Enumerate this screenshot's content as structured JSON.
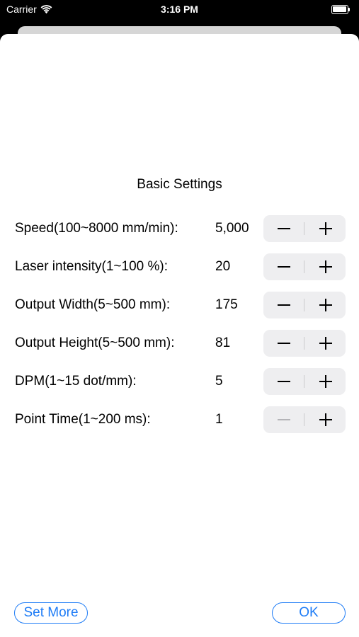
{
  "status_bar": {
    "carrier": "Carrier",
    "time": "3:16 PM",
    "icons": [
      "wifi-icon",
      "battery-icon"
    ]
  },
  "title": "Basic Settings",
  "settings": [
    {
      "label": "Speed(100~8000 mm/min):",
      "value": "5,000",
      "minus_enabled": true,
      "plus_enabled": true
    },
    {
      "label": "Laser intensity(1~100 %):",
      "value": "20",
      "minus_enabled": true,
      "plus_enabled": true
    },
    {
      "label": "Output Width(5~500 mm):",
      "value": "175",
      "minus_enabled": true,
      "plus_enabled": true
    },
    {
      "label": "Output Height(5~500 mm):",
      "value": "81",
      "minus_enabled": true,
      "plus_enabled": true
    },
    {
      "label": "DPM(1~15 dot/mm):",
      "value": "5",
      "minus_enabled": true,
      "plus_enabled": true
    },
    {
      "label": "Point Time(1~200 ms):",
      "value": "1",
      "minus_enabled": false,
      "plus_enabled": true
    }
  ],
  "buttons": {
    "set_more": "Set More",
    "ok": "OK"
  },
  "colors": {
    "accent": "#1e7cf6",
    "stepper_bg": "#eeeef0",
    "disabled_glyph": "#b4b4b8",
    "sheet_back": "#d6d6d6"
  }
}
